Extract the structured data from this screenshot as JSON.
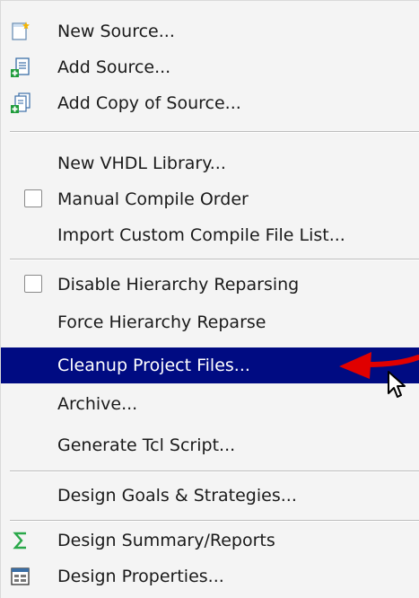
{
  "menu": {
    "items": [
      {
        "label": "New Source...",
        "icon": "new-source-icon"
      },
      {
        "label": "Add Source...",
        "icon": "add-source-icon"
      },
      {
        "label": "Add Copy of Source...",
        "icon": "add-copy-icon"
      },
      {
        "label": "New VHDL Library..."
      },
      {
        "label": "Manual Compile Order",
        "checkbox": "unchecked"
      },
      {
        "label": "Import Custom Compile File List..."
      },
      {
        "label": "Disable Hierarchy Reparsing",
        "checkbox": "unchecked"
      },
      {
        "label": "Force Hierarchy Reparse"
      },
      {
        "label": "Cleanup Project Files...",
        "state": "selected"
      },
      {
        "label": "Archive..."
      },
      {
        "label": "Generate Tcl Script..."
      },
      {
        "label": "Design Goals & Strategies..."
      },
      {
        "label": "Design Summary/Reports",
        "icon": "sigma-icon"
      },
      {
        "label": "Design Properties...",
        "icon": "properties-icon"
      }
    ]
  },
  "colors": {
    "selection": "#000b82",
    "annotation_arrow": "#e00000"
  }
}
